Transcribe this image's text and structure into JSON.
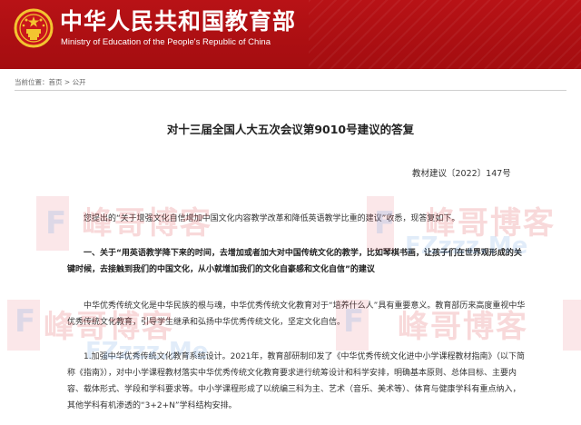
{
  "header": {
    "title": "中华人民共和国教育部",
    "subtitle": "Ministry of Education of the People's Republic of China",
    "bg_color": "#b01014"
  },
  "breadcrumb": {
    "label": "当前位置：",
    "home": "首页",
    "separator": " > ",
    "current": "公开"
  },
  "document": {
    "title": "对十三届全国人大五次会议第9010号建议的答复",
    "doc_number": "教材建议〔2022〕147号",
    "paragraphs": [
      "您提出的“关于增强文化自信增加中国文化内容教学改革和降低英语教学比重的建议”收悉，现答复如下。",
      "一、关于“用英语教学降下来的时间，去增加或者加大对中国传统文化的教学，比如琴棋书画，让孩子们在世界观形成的关键时候，去接触到我们的中国文化，从小就增加我们的文化自豪感和文化自信”的建议",
      "中华优秀传统文化是中华民族的根与魂，中华优秀传统文化教育对于“培养什么人”具有重要意义。教育部历来高度重视中华优秀传统文化教育，引导学生继承和弘扬中华优秀传统文化，坚定文化自信。",
      "1.加强中华优秀传统文化教育系统设计。2021年，教育部研制印发了《中华优秀传统文化进中小学课程教材指南》（以下简称《指南》），对中小学课程教材落实中华优秀传统文化教育要求进行统筹设计和科学安排，明确基本原则、总体目标、主要内容、载体形式、学段和学科要求等。中小学课程形成了以统编三科为主、艺术（音乐、美术等）、体育与健康学科有重点纳入，其他学科有机渗透的“3+2+N”学科结构安排。"
    ]
  },
  "watermarks": {
    "cn_text": "峰哥博客",
    "en_text": "FZzzz.Me",
    "letter": "F"
  },
  "icons": {
    "emblem": "national-emblem-icon"
  }
}
